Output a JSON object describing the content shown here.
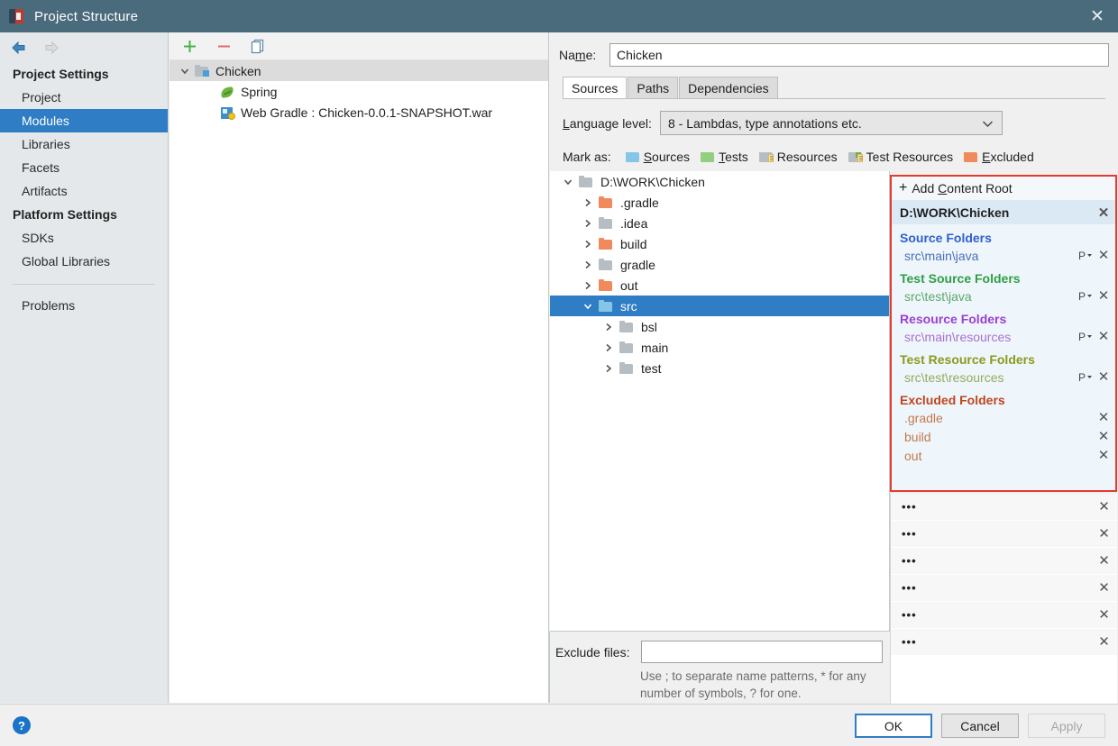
{
  "window": {
    "title": "Project Structure",
    "close_label": "✕",
    "app_icon": "intellij-idea-icon"
  },
  "sidebar": {
    "nav": {
      "back": "back-arrow",
      "forward": "forward-arrow"
    },
    "groups": [
      {
        "label": "Project Settings",
        "items": [
          {
            "label": "Project",
            "selected": false
          },
          {
            "label": "Modules",
            "selected": true
          },
          {
            "label": "Libraries",
            "selected": false
          },
          {
            "label": "Facets",
            "selected": false
          },
          {
            "label": "Artifacts",
            "selected": false
          }
        ]
      },
      {
        "label": "Platform Settings",
        "items": [
          {
            "label": "SDKs",
            "selected": false
          },
          {
            "label": "Global Libraries",
            "selected": false
          }
        ]
      }
    ],
    "problems": {
      "label": "Problems"
    }
  },
  "modules_panel": {
    "toolbar": [
      {
        "name": "add-module-button",
        "glyph": "+"
      },
      {
        "name": "remove-module-button",
        "glyph": "−"
      },
      {
        "name": "copy-module-button",
        "glyph": "copy"
      }
    ],
    "tree": [
      {
        "label": "Chicken",
        "icon": "module-folder-icon",
        "expanded": true,
        "level": 0,
        "selected": true
      },
      {
        "label": "Spring",
        "icon": "spring-leaf-icon",
        "level": 1,
        "selected": false
      },
      {
        "label": "Web Gradle : Chicken-0.0.1-SNAPSHOT.war",
        "icon": "war-artifact-icon",
        "level": 1,
        "selected": false
      }
    ]
  },
  "detail": {
    "name": {
      "label": "Name:",
      "label_prefix": "Na",
      "label_mnemonic": "m",
      "label_suffix": "e:",
      "value": "Chicken",
      "placeholder": ""
    },
    "tabs": [
      {
        "label": "Sources",
        "active": true
      },
      {
        "label": "Paths",
        "active": false
      },
      {
        "label": "Dependencies",
        "active": false
      }
    ],
    "language_level": {
      "label_prefix": "",
      "label_mnemonic": "L",
      "label_suffix": "anguage level:",
      "value": "8 - Lambdas, type annotations etc."
    },
    "mark_as": {
      "label": "Mark as:",
      "options": [
        {
          "label": "Sources",
          "mnemonic": "S",
          "rest": "ources",
          "color": "#85c5e8",
          "kind": "plain"
        },
        {
          "label": "Tests",
          "mnemonic": "T",
          "rest": "ests",
          "color": "#92cf7e",
          "kind": "plain"
        },
        {
          "label": "Resources",
          "mnemonic": "",
          "rest": "Resources",
          "color": "#b6bec4",
          "kind": "lines"
        },
        {
          "label": "Test Resources",
          "mnemonic": "",
          "rest": "Test Resources",
          "color": "#b6bec4",
          "kind": "lines-green"
        },
        {
          "label": "Excluded",
          "mnemonic": "E",
          "rest": "xcluded",
          "color": "#f08a5d",
          "kind": "plain"
        }
      ]
    },
    "folder_tree": [
      {
        "label": "D:\\WORK\\Chicken",
        "level": 0,
        "expanded": true,
        "twisty": "down",
        "color": "gray",
        "selected": false
      },
      {
        "label": ".gradle",
        "level": 1,
        "twisty": "right",
        "color": "orange",
        "selected": false
      },
      {
        "label": ".idea",
        "level": 1,
        "twisty": "right",
        "color": "gray",
        "selected": false
      },
      {
        "label": "build",
        "level": 1,
        "twisty": "right",
        "color": "orange",
        "selected": false
      },
      {
        "label": "gradle",
        "level": 1,
        "twisty": "right",
        "color": "gray",
        "selected": false
      },
      {
        "label": "out",
        "level": 1,
        "twisty": "right",
        "color": "orange",
        "selected": false
      },
      {
        "label": "src",
        "level": 1,
        "twisty": "down",
        "color": "blue",
        "selected": true
      },
      {
        "label": "bsl",
        "level": 2,
        "twisty": "right",
        "color": "gray",
        "selected": false
      },
      {
        "label": "main",
        "level": 2,
        "twisty": "right",
        "color": "gray",
        "selected": false
      },
      {
        "label": "test",
        "level": 2,
        "twisty": "right",
        "color": "gray",
        "selected": false
      }
    ],
    "exclude_files": {
      "label": "Exclude files:",
      "value": "",
      "placeholder": "",
      "hint": "Use ; to separate name patterns, * for any number of symbols, ? for one."
    }
  },
  "content_roots": {
    "border_color": "#e8392b",
    "add_button": {
      "plus": "+",
      "prefix": "Add ",
      "mnemonic": "C",
      "suffix": "ontent Root"
    },
    "root_path": "D:\\WORK\\Chicken",
    "root_remove": "✕",
    "categories": [
      {
        "title": "Source Folders",
        "color": "#2f5fd0",
        "items": [
          {
            "path": "src\\main\\java",
            "has_package_prefix": true,
            "remove": "✕"
          }
        ]
      },
      {
        "title": "Test Source Folders",
        "color": "#2f9e44",
        "items": [
          {
            "path": "src\\test\\java",
            "has_package_prefix": true,
            "remove": "✕"
          }
        ]
      },
      {
        "title": "Resource Folders",
        "color": "#9b3fd4",
        "items": [
          {
            "path": "src\\main\\resources",
            "has_package_prefix": true,
            "remove": "✕"
          }
        ]
      },
      {
        "title": "Test Resource Folders",
        "color": "#8a9a1e",
        "items": [
          {
            "path": "src\\test\\resources",
            "has_package_prefix": true,
            "remove": "✕"
          }
        ]
      },
      {
        "title": "Excluded Folders",
        "color": "#c0451f",
        "items": [
          {
            "path": ".gradle",
            "has_package_prefix": false,
            "remove": "✕"
          },
          {
            "path": "build",
            "has_package_prefix": false,
            "remove": "✕"
          },
          {
            "path": "out",
            "has_package_prefix": false,
            "remove": "✕"
          }
        ]
      }
    ],
    "placeholder_rows": [
      {
        "label": "•••",
        "remove": "✕"
      },
      {
        "label": "•••",
        "remove": "✕"
      },
      {
        "label": "•••",
        "remove": "✕"
      },
      {
        "label": "•••",
        "remove": "✕"
      },
      {
        "label": "•••",
        "remove": "✕"
      },
      {
        "label": "•••",
        "remove": "✕"
      }
    ]
  },
  "footer": {
    "help": "?",
    "ok": "OK",
    "cancel": "Cancel",
    "apply": "Apply",
    "apply_disabled": true
  },
  "colors": {
    "titlebar": "#4a6b7c",
    "selection": "#2f7dc4",
    "panel": "#f0f0f0",
    "alert_border": "#e8392b"
  }
}
